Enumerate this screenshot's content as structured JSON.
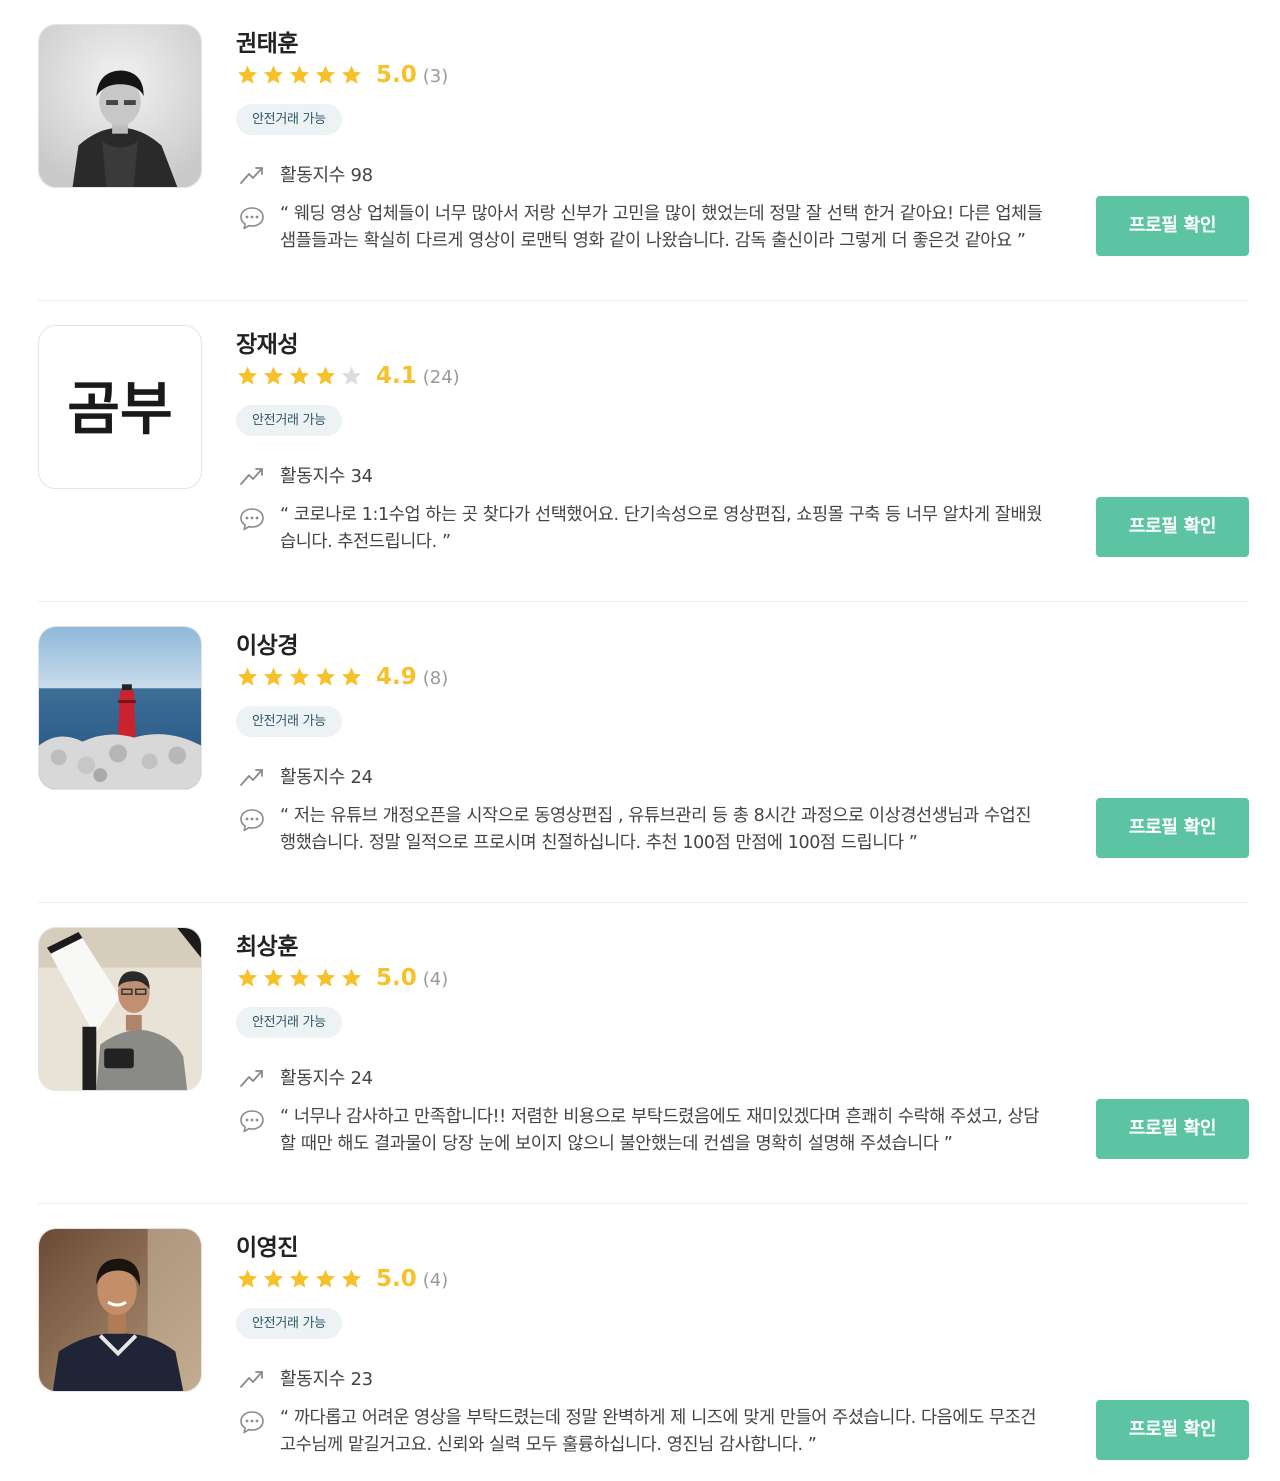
{
  "colors": {
    "accent": "#5cc4a3",
    "star": "#f6c12a",
    "star_empty": "#dddddd",
    "badge_bg": "#edf2f5"
  },
  "icons": {
    "star": "star-icon",
    "activity": "trend-up-icon",
    "review": "speech-bubble-icon"
  },
  "experts": [
    {
      "name": "권태훈",
      "rating": "5.0",
      "stars_filled": 5,
      "review_count": "(3)",
      "badge": "안전거래 가능",
      "activity": "활동지수 98",
      "review": "“ 웨딩 영상 업체들이 너무 많아서 저랑 신부가 고민을 많이 했었는데 정말 잘 선택 한거 같아요! 다른 업체들 샘플들과는 확실히 다르게 영상이 로맨틱 영화 같이 나왔습니다. 감독 출신이라 그렇게 더 좋은것 같아요 ”",
      "button": "프로필 확인"
    },
    {
      "name": "장재성",
      "rating": "4.1",
      "stars_filled": 4,
      "review_count": "(24)",
      "badge": "안전거래 가능",
      "activity": "활동지수 34",
      "review": "“ 코로나로 1:1수업 하는 곳 찾다가 선택했어요. 단기속성으로 영상편집, 쇼핑몰 구축 등 너무 알차게 잘배웠습니다. 추전드립니다. ”",
      "button": "프로필 확인",
      "avatar_text": "곰부"
    },
    {
      "name": "이상경",
      "rating": "4.9",
      "stars_filled": 5,
      "review_count": "(8)",
      "badge": "안전거래 가능",
      "activity": "활동지수 24",
      "review": "“ 저는 유튜브 개정오픈을 시작으로 동영상편집 , 유튜브관리 등 총 8시간 과정으로 이상경선생님과 수업진행했습니다. 정말 일적으로 프로시며 친절하십니다. 추천 100점 만점에 100점 드립니다 ”",
      "button": "프로필 확인"
    },
    {
      "name": "최상훈",
      "rating": "5.0",
      "stars_filled": 5,
      "review_count": "(4)",
      "badge": "안전거래 가능",
      "activity": "활동지수 24",
      "review": "“ 너무나 감사하고 만족합니다!! 저렴한 비용으로 부탁드렸음에도 재미있겠다며 흔쾌히 수락해 주셨고, 상담 할 때만 해도 결과물이 당장 눈에 보이지 않으니 불안했는데 컨셉을 명확히 설명해 주셨습니다 ”",
      "button": "프로필 확인"
    },
    {
      "name": "이영진",
      "rating": "5.0",
      "stars_filled": 5,
      "review_count": "(4)",
      "badge": "안전거래 가능",
      "activity": "활동지수 23",
      "review": "“ 까다롭고 어려운 영상을 부탁드렸는데 정말 완벽하게 제 니즈에 맞게 만들어 주셨습니다. 다음에도 무조건 고수님께 맡길거고요. 신뢰와 실력 모두 훌륭하십니다. 영진님 감사합니다. ”",
      "button": "프로필 확인"
    }
  ]
}
